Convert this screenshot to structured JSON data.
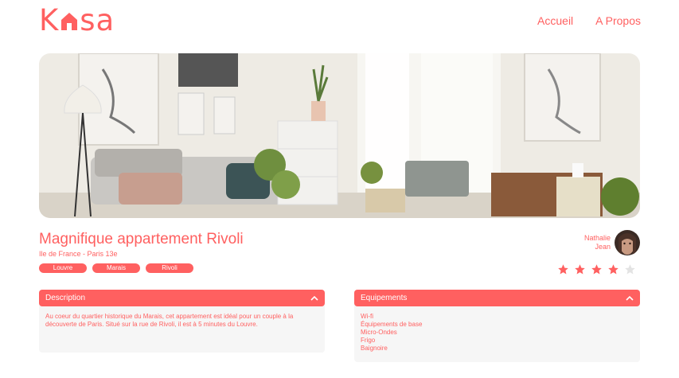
{
  "brand": {
    "logo_left": "K",
    "logo_right": "sa",
    "logo_icon": "house-icon",
    "accent": "#ff6060"
  },
  "nav": {
    "home": "Accueil",
    "about": "A Propos"
  },
  "listing": {
    "title": "Magnifique appartement Rivoli",
    "location": "Ile de France - Paris 13e",
    "tags": [
      "Louvre",
      "Marais",
      "Rivoli"
    ]
  },
  "host": {
    "first_name": "Nathalie",
    "last_name": "Jean"
  },
  "rating": {
    "value": 4,
    "max": 5
  },
  "description": {
    "label": "Description",
    "text": "Au coeur du quartier historique du Marais, cet appartement est idéal pour un couple à la découverte de Paris. Situé sur la rue de Rivoli, il est à 5 minutes du Louvre."
  },
  "equipments": {
    "label": "Equipements",
    "items": [
      "Wi-fi",
      "Équipements de base",
      "Micro-Ondes",
      "Frigo",
      "Baignoire"
    ]
  }
}
